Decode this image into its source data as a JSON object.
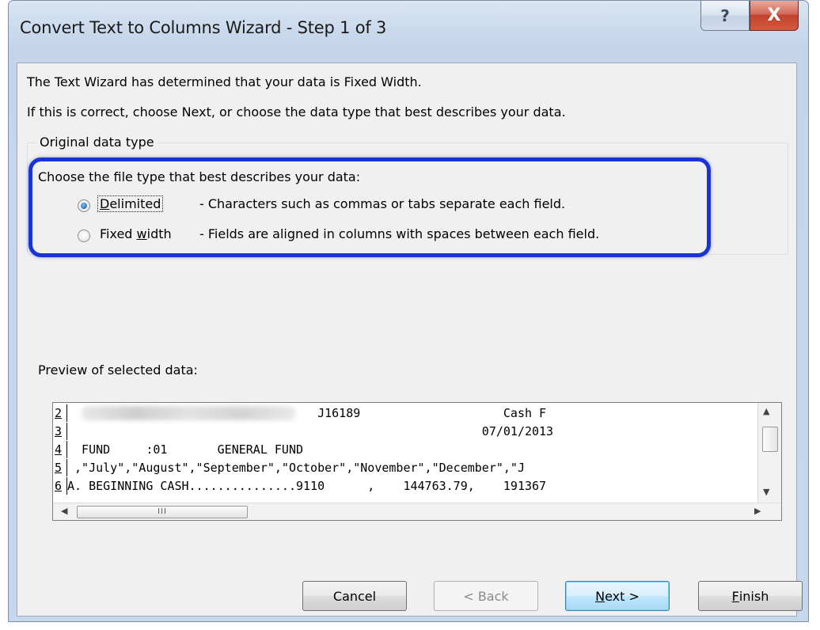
{
  "window": {
    "title": "Convert Text to Columns Wizard - Step 1 of 3",
    "help_glyph": "?",
    "close_glyph": "X"
  },
  "intro": {
    "line1": "The Text Wizard has determined that your data is Fixed Width.",
    "line2": "If this is correct, choose Next, or choose the data type that best describes your data."
  },
  "group": {
    "legend": "Original data type",
    "prompt": "Choose the file type that best describes your data:",
    "options": [
      {
        "label_pre": "",
        "label_acc": "D",
        "label_post": "elimited",
        "description": "- Characters such as commas or tabs separate each field.",
        "checked": true
      },
      {
        "label_pre": "Fixed ",
        "label_acc": "w",
        "label_post": "idth",
        "description": "- Fields are aligned in columns with spaces between each field.",
        "checked": false
      }
    ]
  },
  "preview": {
    "label": "Preview of selected data:",
    "rows": [
      {
        "num": "2",
        "text": "                                   J16189                    Cash F"
      },
      {
        "num": "3",
        "text": "                                                          07/01/2013"
      },
      {
        "num": "4",
        "text": "  FUND     :01       GENERAL FUND"
      },
      {
        "num": "5",
        "text": " ,\"July\",\"August\",\"September\",\"October\",\"November\",\"December\",\"J"
      },
      {
        "num": "6",
        "text": "A. BEGINNING CASH...............9110      ,    144763.79,    191367"
      }
    ],
    "hscroll_grip": "III"
  },
  "buttons": {
    "cancel": "Cancel",
    "back": "< Back",
    "next_acc": "N",
    "next_post": "ext >",
    "finish_acc": "F",
    "finish_post": "inish"
  },
  "colors": {
    "highlight": "#1a33d9",
    "radio_checked": "#2a6fc1"
  }
}
